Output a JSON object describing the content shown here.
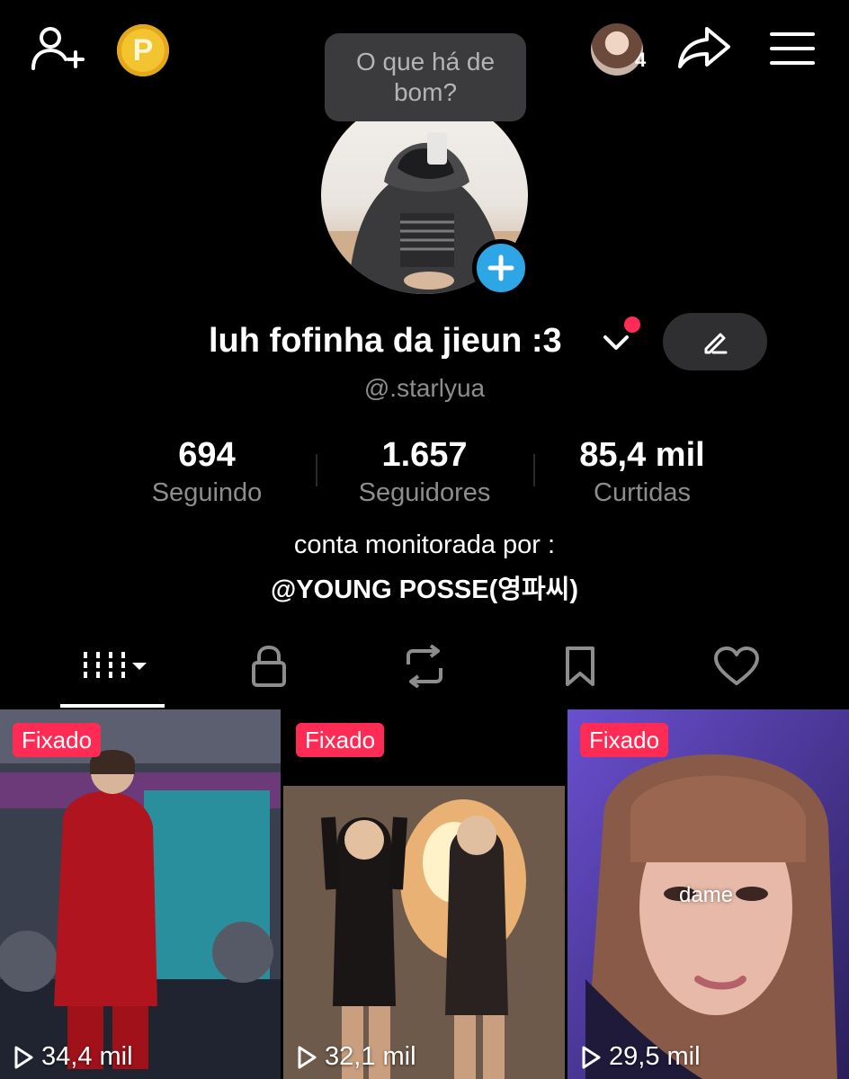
{
  "top_bar": {
    "coin_letter": "P",
    "friend_count": "4"
  },
  "tooltip": {
    "text": "O que há de bom?"
  },
  "profile": {
    "name": "luh fofinha da jieun :3",
    "handle": "@.starlyua"
  },
  "stats": [
    {
      "value": "694",
      "label": "Seguindo"
    },
    {
      "value": "1.657",
      "label": "Seguidores"
    },
    {
      "value": "85,4 mil",
      "label": "Curtidas"
    }
  ],
  "bio": {
    "line1": "conta monitorada por :",
    "line2": "@YOUNG POSSE(영파씨)"
  },
  "videos": [
    {
      "badge": "Fixado",
      "views": "34,4 mil"
    },
    {
      "badge": "Fixado",
      "views": "32,1 mil"
    },
    {
      "badge": "Fixado",
      "views": "29,5 mil",
      "caption": "dame"
    }
  ],
  "colors": {
    "background": "#000000",
    "accent_red": "#fe2c55",
    "plus_blue": "#2ea6e6",
    "muted_text": "#8d8d90"
  }
}
